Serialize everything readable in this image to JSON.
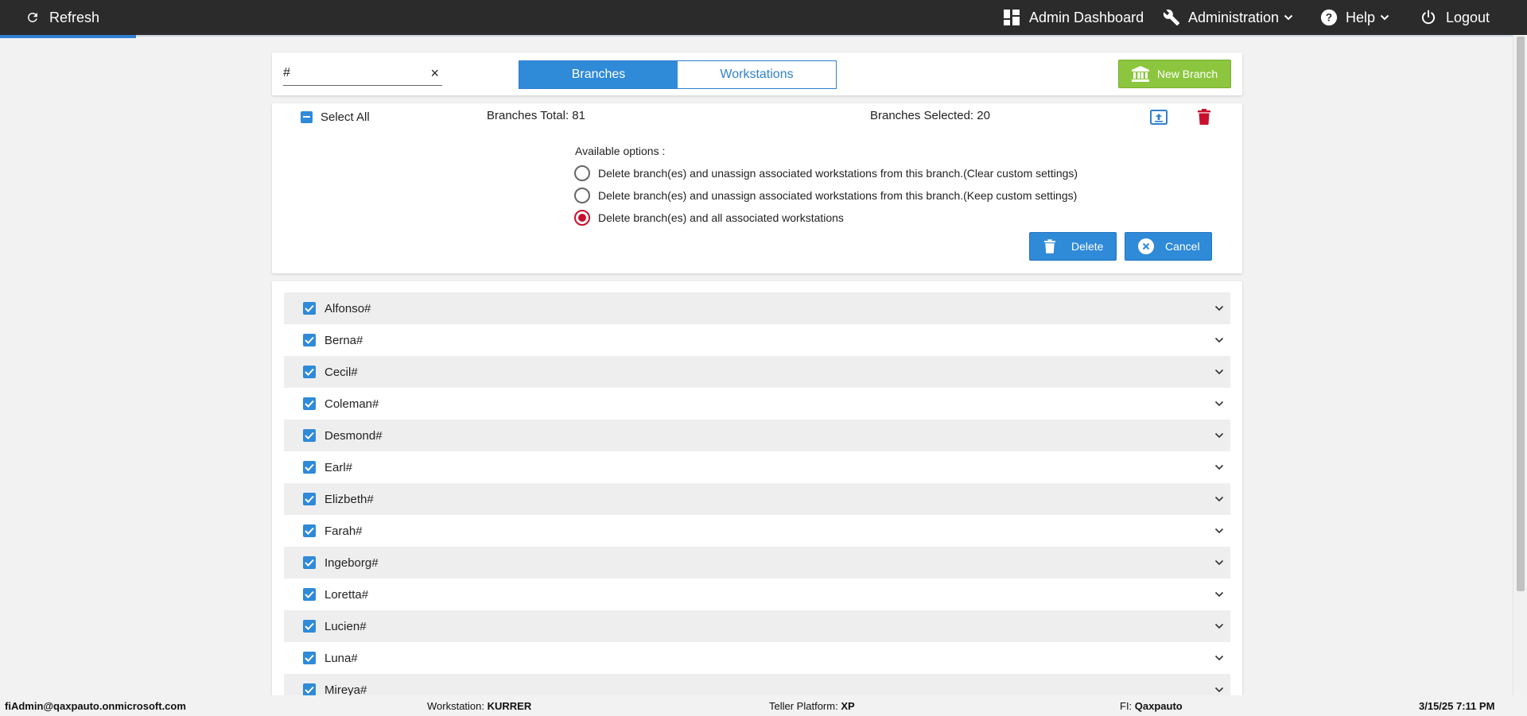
{
  "topbar": {
    "refresh": "Refresh",
    "admin_dashboard": "Admin Dashboard",
    "administration": "Administration",
    "help": "Help",
    "logout": "Logout"
  },
  "header": {
    "search_value": "#",
    "clear_symbol": "×",
    "tabs": {
      "branches": "Branches",
      "workstations": "Workstations"
    },
    "active_tab": "Branches",
    "new_branch": "New Branch"
  },
  "panel": {
    "select_all": "Select All",
    "branches_total": "Branches Total: 81",
    "branches_selected": "Branches Selected: 20",
    "options_label": "Available options :",
    "options": [
      {
        "label": "Delete branch(es) and unassign associated workstations from this branch.(Clear custom settings)",
        "checked": false
      },
      {
        "label": "Delete branch(es) and unassign associated workstations from this branch.(Keep custom settings)",
        "checked": false
      },
      {
        "label": "Delete branch(es) and all associated workstations",
        "checked": true
      }
    ],
    "delete": "Delete",
    "cancel": "Cancel"
  },
  "branches": [
    "Alfonso#",
    "Berna#",
    "Cecil#",
    "Coleman#",
    "Desmond#",
    "Earl#",
    "Elizbeth#",
    "Farah#",
    "Ingeborg#",
    "Loretta#",
    "Lucien#",
    "Luna#",
    "Mireya#"
  ],
  "footer": {
    "user": "fiAdmin@qaxpauto.onmicrosoft.com",
    "workstation_label": "Workstation: ",
    "workstation_value": "KURRER",
    "platform_label": "Teller Platform: ",
    "platform_value": "XP",
    "fi_label": "FI: ",
    "fi_value": "Qaxpauto",
    "datetime": "3/15/25 7:11 PM"
  },
  "colors": {
    "accent_blue": "#2f8ad8",
    "new_branch_green": "#8cc63f",
    "danger_red": "#c8102e",
    "topbar": "#2b2b2b"
  },
  "icons": {
    "refresh": "refresh-icon",
    "admin_dashboard": "dashboard-grid-icon",
    "administration": "wrench-icon",
    "help": "question-circle-icon",
    "logout": "power-icon",
    "new_branch": "bank-icon",
    "export": "export-upload-icon",
    "trash": "trash-icon",
    "cancel": "close-circle-icon",
    "expand": "chevron-down-icon"
  }
}
